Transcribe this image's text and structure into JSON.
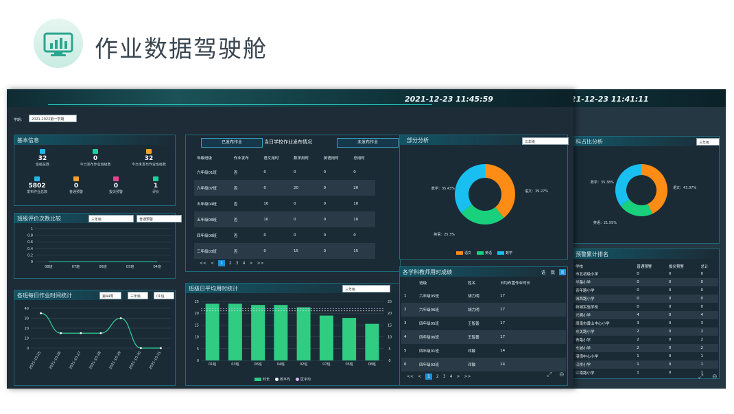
{
  "page": {
    "title": "作业数据驾驶舱"
  },
  "colors": {
    "orange": "#ff8c14",
    "green": "#19d07d",
    "blue": "#18bff0",
    "teal_bar": "#2fcc82"
  },
  "screen_a": {
    "datetime": "2021-12-23 11:45:59",
    "term": {
      "label": "学期：",
      "value": "2021-2022第一学期"
    },
    "basic_info": {
      "title": "基本信息",
      "stats": [
        {
          "value": "32",
          "label": "班级总数",
          "icon": "class-icon"
        },
        {
          "value": "0",
          "label": "今日发布作业班级数",
          "icon": "homework-icon"
        },
        {
          "value": "32",
          "label": "今日未发布作业班级数",
          "icon": "book-icon"
        },
        {
          "value": "5802",
          "label": "发布作业总数",
          "icon": "publish-icon"
        },
        {
          "value": "0",
          "label": "普通预警",
          "icon": "warning-icon"
        },
        {
          "value": "0",
          "label": "拔尖预警",
          "icon": "top-icon"
        },
        {
          "value": "1",
          "label": "评价",
          "icon": "comment-icon"
        }
      ]
    },
    "class_eval": {
      "title": "班级评价次数比较",
      "select1": "三年级",
      "select2": "普通预警",
      "chart_data": {
        "type": "line",
        "categories": [
          "08班",
          "07班",
          "06班",
          "05班",
          "04班"
        ],
        "values": [
          0,
          0,
          0,
          0,
          0
        ],
        "yticks": [
          "0",
          "0.2",
          "0.4",
          "0.6",
          "0.8",
          "1"
        ],
        "ylim": [
          0,
          1
        ]
      }
    },
    "daily_time": {
      "title": "各班每日作业时间统计",
      "select_week": "第44周",
      "select_grade": "三年级",
      "select_class": "01班",
      "chart_data": {
        "type": "line",
        "categories": [
          "2021-10-25",
          "2021-10-26",
          "2021-10-27",
          "2021-10-28",
          "2021-10-29",
          "2021-10-30",
          "2021-10-31"
        ],
        "values": [
          35,
          15,
          15,
          15,
          30,
          0,
          0
        ],
        "yticks": [
          "0",
          "10",
          "20",
          "30",
          "40"
        ],
        "ylim": [
          0,
          40
        ]
      }
    },
    "publish_status": {
      "title": "当日学校作业发布情况",
      "tab_published": "已发布作业",
      "tab_unpublished": "未发布作业",
      "columns": [
        "年级班级",
        "作业发布",
        "语文用时",
        "数学用时",
        "英语用时",
        "总用时"
      ],
      "rows": [
        [
          "六年级01班",
          "否",
          "0",
          "0",
          "0",
          "0"
        ],
        [
          "六年级07班",
          "否",
          "0",
          "20",
          "0",
          "20"
        ],
        [
          "五年级04班",
          "否",
          "10",
          "0",
          "0",
          "10"
        ],
        [
          "五年级08班",
          "否",
          "10",
          "0",
          "0",
          "10"
        ],
        [
          "四年级08班",
          "否",
          "0",
          "0",
          "0",
          "0"
        ],
        [
          "三年级03班",
          "否",
          "0",
          "15",
          "0",
          "15"
        ]
      ],
      "pager": [
        "<<",
        "<",
        "1",
        "2",
        "3",
        "4",
        ">",
        ">>"
      ]
    },
    "avg_time": {
      "title": "班级日平均用时统计",
      "select": "三年级",
      "legend": [
        "时长",
        "校平均",
        "区平均"
      ],
      "chart_data": {
        "type": "bar",
        "categories": [
          "01班",
          "03班",
          "06班",
          "04班",
          "02班",
          "07班",
          "05班",
          "08班"
        ],
        "values": [
          24,
          24,
          23.5,
          23.5,
          22.5,
          19,
          18,
          15.5
        ],
        "school_avg": 22,
        "district_avg": 21,
        "yticks": [
          "0",
          "5",
          "10",
          "15",
          "20",
          "25"
        ],
        "ylim": [
          0,
          25
        ]
      }
    },
    "subject_analysis": {
      "title": "部分分析",
      "select": "三年级",
      "chart_data": {
        "type": "pie",
        "labels": [
          "语文",
          "英语",
          "数学"
        ],
        "values": [
          39.27,
          25.3,
          35.43
        ],
        "slice_labels": [
          "语文：39.27%",
          "英语：25.3%",
          "数学：35.43%"
        ]
      }
    },
    "teacher_time": {
      "title": "各学科教师用时成绩",
      "tabs": [
        "语",
        "数",
        "英"
      ],
      "columns": [
        "",
        "班级",
        "姓名",
        "日均布置作业时长"
      ],
      "rows": [
        [
          "1",
          "六年级05班",
          "胡力明",
          "17"
        ],
        [
          "2",
          "六年级06班",
          "胡力明",
          "17"
        ],
        [
          "3",
          "四年级05班",
          "王智善",
          "17"
        ],
        [
          "4",
          "四年级06班",
          "王智善",
          "17"
        ],
        [
          "5",
          "四年级01班",
          "邓敏",
          "14"
        ],
        [
          "6",
          "四年级02班",
          "邓敏",
          "14"
        ]
      ],
      "pager": [
        "<<",
        "<",
        "1",
        "2",
        "3",
        "4",
        ">",
        ">>"
      ]
    }
  },
  "screen_b": {
    "datetime": "21-12-23 11:41:11",
    "subject_ratio": {
      "title": "科占比分析",
      "select": "三年级",
      "chart_data": {
        "type": "pie",
        "labels": [
          "语文",
          "英语",
          "数学"
        ],
        "values": [
          43.07,
          21.55,
          35.38
        ],
        "slice_labels": [
          "语文：43.07%",
          "英语：21.55%",
          "数学：35.38%"
        ]
      }
    },
    "warning_rank": {
      "title": "预警累计排名",
      "columns": [
        "学校",
        "普通预警",
        "拔尖预警",
        "总计"
      ],
      "rows": [
        [
          "市北初级小学",
          "0",
          "0",
          "0"
        ],
        [
          "华路小学",
          "0",
          "0",
          "0"
        ],
        [
          "青年路小学",
          "0",
          "0",
          "0"
        ],
        [
          "城西路小学",
          "0",
          "0",
          "0"
        ],
        [
          "新城实验学校",
          "0",
          "0",
          "0"
        ],
        [
          "光明小学",
          "4",
          "0",
          "4"
        ],
        [
          "周南市黄山中心小学",
          "3",
          "0",
          "3"
        ],
        [
          "东关路小学",
          "2",
          "0",
          "2"
        ],
        [
          "青路小学",
          "2",
          "0",
          "2"
        ],
        [
          "东城小学",
          "2",
          "0",
          "2"
        ],
        [
          "港湾中心小学",
          "1",
          "0",
          "1"
        ],
        [
          "汉桥小学",
          "1",
          "0",
          "1"
        ],
        [
          "江南路小学",
          "1",
          "0",
          "1"
        ]
      ]
    }
  }
}
